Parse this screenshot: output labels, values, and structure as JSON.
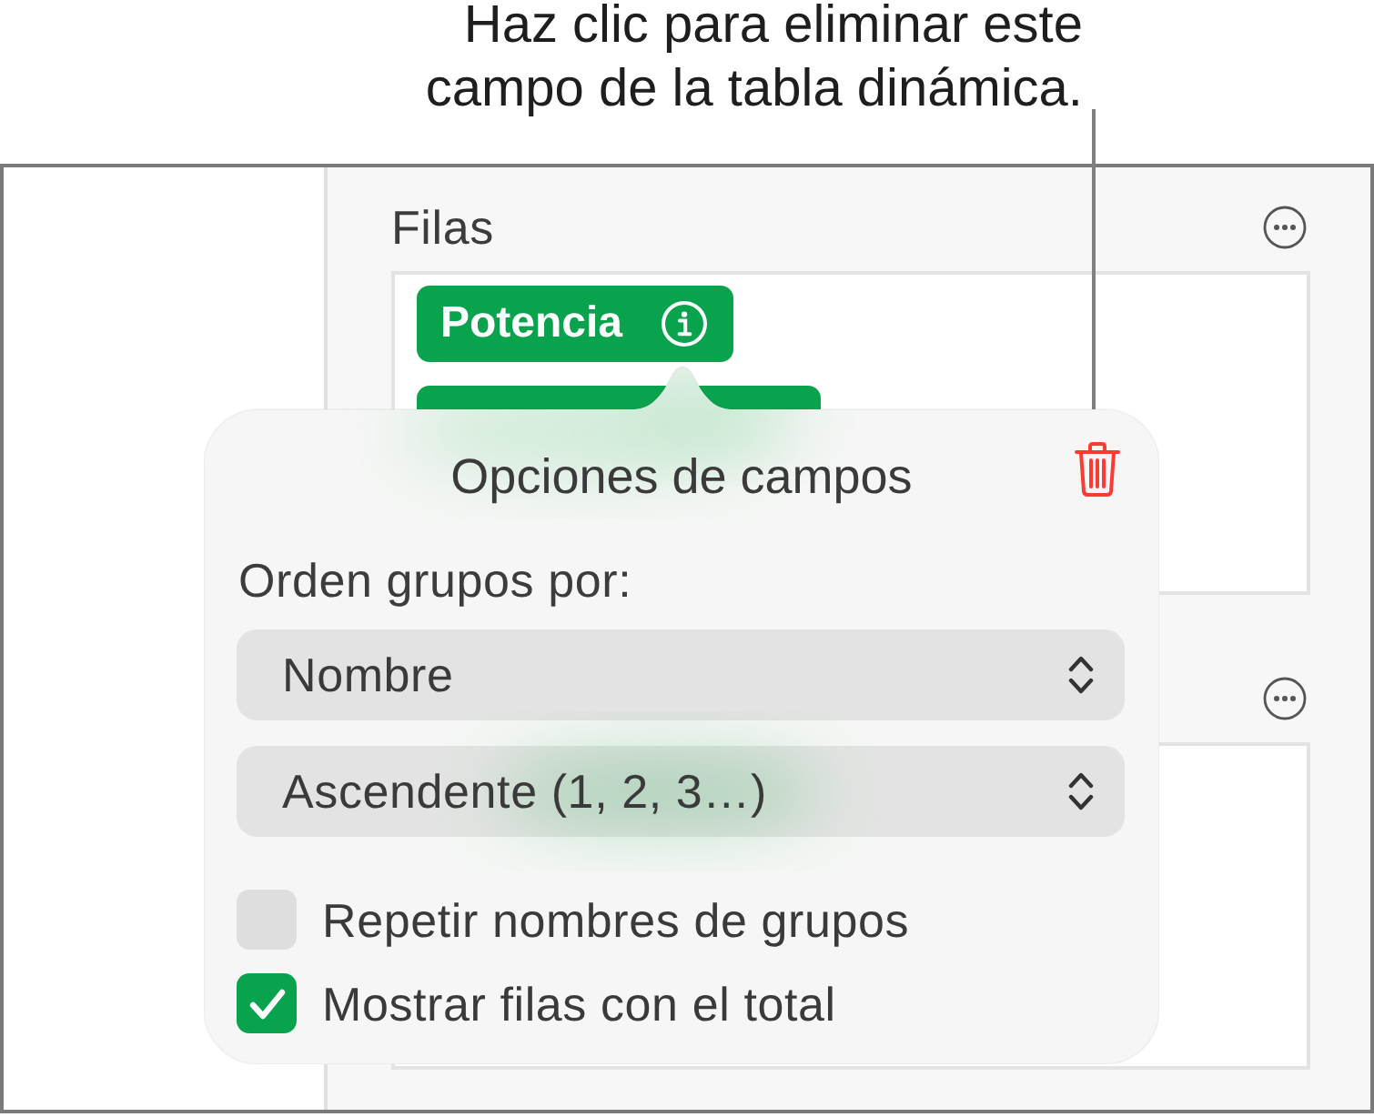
{
  "callout": {
    "lines": [
      "Haz clic para eliminar este",
      "campo de la tabla dinámica."
    ]
  },
  "rows_section": {
    "label": "Filas",
    "fields": [
      {
        "label": "Potencia"
      }
    ]
  },
  "popover": {
    "title": "Opciones de campos",
    "sort_label": "Orden grupos por:",
    "dropdowns": [
      {
        "value": "Nombre"
      },
      {
        "value": "Ascendente (1, 2, 3…)"
      }
    ],
    "checkboxes": [
      {
        "label": "Repetir nombres de grupos",
        "checked": false
      },
      {
        "label": "Mostrar filas con el total",
        "checked": true
      }
    ]
  }
}
